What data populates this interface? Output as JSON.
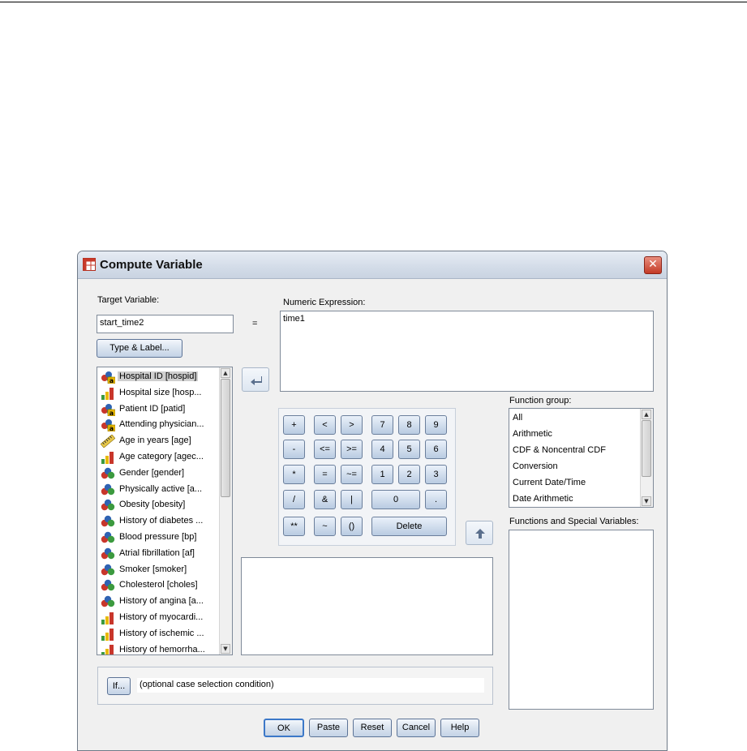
{
  "window": {
    "title": "Compute Variable",
    "close_glyph": "✕"
  },
  "target_variable": {
    "label": "Target Variable:",
    "value": "start_time2"
  },
  "equals_sign": "=",
  "numeric_expression": {
    "label": "Numeric Expression:",
    "value": "time1"
  },
  "type_label_button": "Type & Label...",
  "variables": [
    {
      "name": "Hospital ID [hospid]",
      "icon": "nominal-string-icon",
      "selected": true
    },
    {
      "name": "Hospital size [hosp...",
      "icon": "ordinal-icon"
    },
    {
      "name": "Patient ID [patid]",
      "icon": "nominal-string-icon"
    },
    {
      "name": "Attending physician...",
      "icon": "nominal-string-icon"
    },
    {
      "name": "Age in years [age]",
      "icon": "scale-ruler-icon"
    },
    {
      "name": "Age category [agec...",
      "icon": "ordinal-icon"
    },
    {
      "name": "Gender [gender]",
      "icon": "nominal-icon"
    },
    {
      "name": "Physically active [a...",
      "icon": "nominal-icon"
    },
    {
      "name": "Obesity [obesity]",
      "icon": "nominal-icon"
    },
    {
      "name": "History of diabetes ...",
      "icon": "nominal-icon"
    },
    {
      "name": "Blood pressure [bp]",
      "icon": "nominal-icon"
    },
    {
      "name": "Atrial fibrillation [af]",
      "icon": "nominal-icon"
    },
    {
      "name": "Smoker [smoker]",
      "icon": "nominal-icon"
    },
    {
      "name": "Cholesterol [choles]",
      "icon": "nominal-icon"
    },
    {
      "name": "History of angina [a...",
      "icon": "nominal-icon"
    },
    {
      "name": "History of myocardi...",
      "icon": "ordinal-icon"
    },
    {
      "name": "History of ischemic ...",
      "icon": "ordinal-icon"
    },
    {
      "name": "History of hemorrha...",
      "icon": "ordinal-icon"
    }
  ],
  "calculator": {
    "row1": [
      "+",
      "<",
      ">",
      "7",
      "8",
      "9"
    ],
    "row2": [
      "-",
      "<=",
      ">=",
      "4",
      "5",
      "6"
    ],
    "row3": [
      "*",
      "=",
      "~=",
      "1",
      "2",
      "3"
    ],
    "row4": [
      "/",
      "&",
      "|",
      "0",
      "."
    ],
    "row5": [
      "**",
      "~",
      "()",
      "Delete"
    ]
  },
  "function_group": {
    "label": "Function group:",
    "items": [
      "All",
      "Arithmetic",
      "CDF & Noncentral CDF",
      "Conversion",
      "Current Date/Time",
      "Date Arithmetic"
    ]
  },
  "functions_special": {
    "label": "Functions and Special Variables:"
  },
  "if_panel": {
    "button": "If...",
    "condition": "(optional case selection condition)"
  },
  "buttons": {
    "ok": "OK",
    "paste": "Paste",
    "reset": "Reset",
    "cancel": "Cancel",
    "help": "Help"
  },
  "colors": {
    "title_gradient_top": "#e7ecf4",
    "close_red": "#c33a26",
    "button_border": "#5c7396",
    "selection_gray": "#cfcfcf"
  }
}
